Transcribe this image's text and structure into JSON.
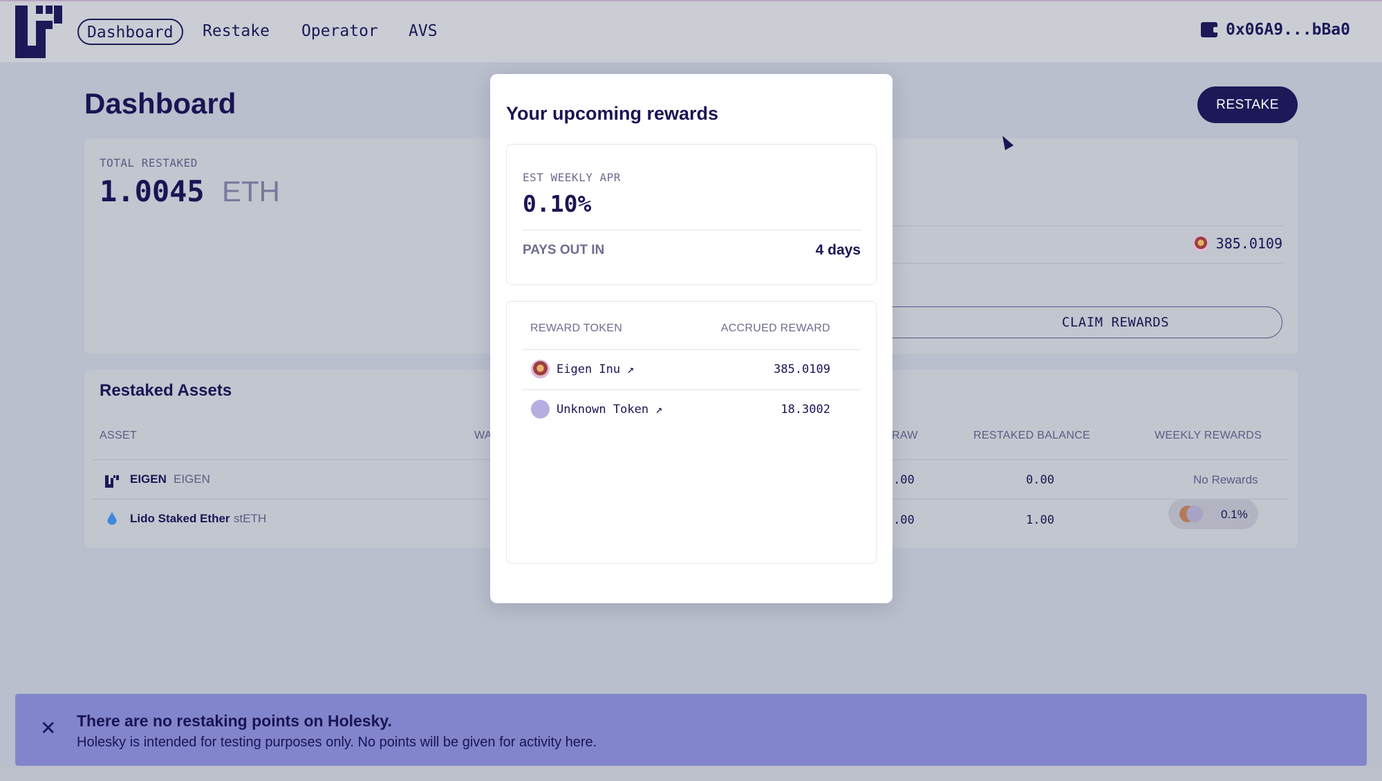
{
  "nav": {
    "tabs": [
      {
        "label": "Dashboard"
      },
      {
        "label": "Restake"
      },
      {
        "label": "Operator"
      },
      {
        "label": "AVS"
      }
    ],
    "wallet_address": "0x06A9...bBa0",
    "wallet_icon": "wallet-icon"
  },
  "dashboard": {
    "title": "Dashboard",
    "restake_label": "RESTAKE",
    "total_restaked": {
      "label": "TOTAL RESTAKED",
      "value": "1.0045",
      "unit": "ETH"
    },
    "rewards_value": "385.0109",
    "claim_label": "CLAIM REWARDS",
    "restaked_assets": {
      "title": "Restaked Assets",
      "headers": [
        "ASSET",
        "WA",
        "RAW",
        "RESTAKED BALANCE",
        "WEEKLY REWARDS"
      ],
      "rows": [
        {
          "name": "EIGEN",
          "symbol": "EIGEN",
          "withdraw": ".00",
          "balance": "0.00",
          "rewards": "No Rewards"
        },
        {
          "name": "Lido Staked Ether",
          "symbol": "stETH",
          "withdraw": ".00",
          "balance": "1.00",
          "rewards": "0.1%"
        }
      ]
    }
  },
  "modal": {
    "title": "Your upcoming rewards",
    "apr_label": "EST WEEKLY APR",
    "apr_value": "0.10%",
    "pays_out_label": "PAYS OUT IN",
    "pays_out_value": "4 days",
    "table_headers": [
      "REWARD TOKEN",
      "ACCRUED REWARD"
    ],
    "tokens": [
      {
        "name": "Eigen Inu",
        "amount": "385.0109"
      },
      {
        "name": "Unknown Token",
        "amount": "18.3002"
      }
    ]
  },
  "toast": {
    "title": "There are no restaking points on Holesky.",
    "message": "Holesky is intended for testing purposes only. No points will be given for activity here."
  },
  "colors": {
    "brand": "#1d1858",
    "toast_bg": "#8285cc",
    "backdrop": "#b9bfcc"
  }
}
